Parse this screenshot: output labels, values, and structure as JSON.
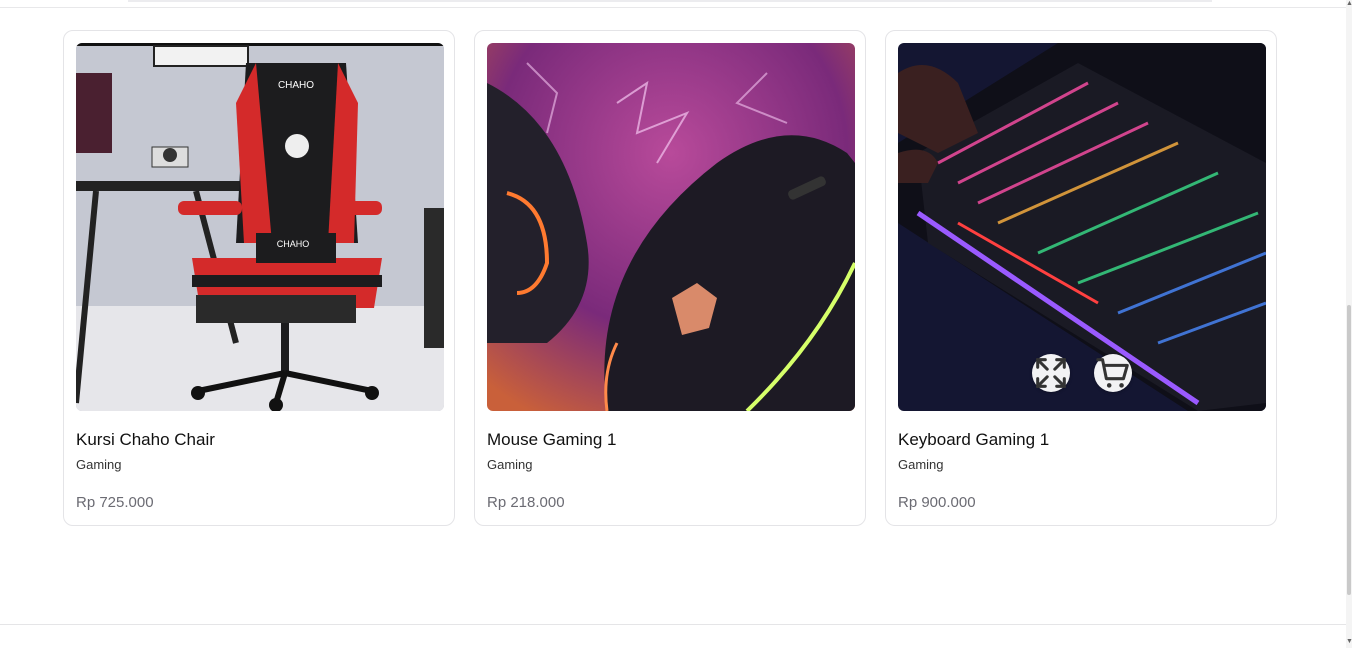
{
  "products": [
    {
      "name": "Kursi Chaho Chair",
      "category": "Gaming",
      "price": "Rp 725.000",
      "image_text": "CHAHO"
    },
    {
      "name": "Mouse Gaming 1",
      "category": "Gaming",
      "price": "Rp 218.000"
    },
    {
      "name": "Keyboard Gaming 1",
      "category": "Gaming",
      "price": "Rp 900.000"
    }
  ],
  "actions": {
    "expand_icon": "expand-icon",
    "cart_icon": "cart-icon"
  },
  "colors": {
    "price_text": "#6b6b73",
    "card_border": "#e4e4e7",
    "chair_red": "#d42a2a",
    "mouse_bg": "#8a2f8a"
  }
}
